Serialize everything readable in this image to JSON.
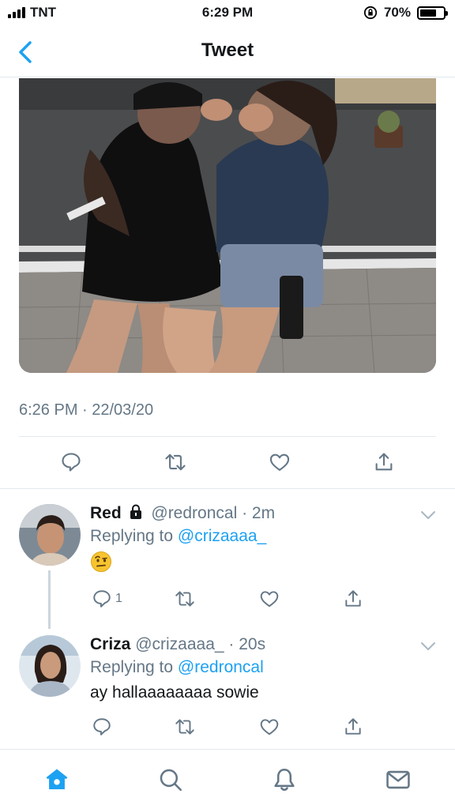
{
  "status_bar": {
    "carrier": "TNT",
    "time": "6:29 PM",
    "battery": "70%",
    "battery_level": 0.7
  },
  "header": {
    "title": "Tweet"
  },
  "tweet": {
    "timestamp": "6:26 PM · 22/03/20",
    "icons": [
      "reply-icon",
      "retweet-icon",
      "like-icon",
      "share-icon"
    ]
  },
  "replies": [
    {
      "name": "Red",
      "handle": "@redroncal",
      "age": "2m",
      "replying_prefix": "Replying to ",
      "replying_to": "@crizaaaa_",
      "text": "",
      "reply_count": "1"
    },
    {
      "name": "Criza",
      "handle": "@crizaaaa_",
      "age": "20s",
      "replying_prefix": "Replying to ",
      "replying_to": "@redroncal",
      "text": "ay hallaaaaaaaa sowie",
      "reply_count": ""
    }
  ],
  "tabbar": {
    "tabs": [
      "home-icon",
      "search-icon",
      "notifications-icon",
      "messages-icon"
    ]
  },
  "colors": {
    "accent": "#1da1f2",
    "secondary_text": "#657786",
    "divider": "#e1e8ed"
  }
}
